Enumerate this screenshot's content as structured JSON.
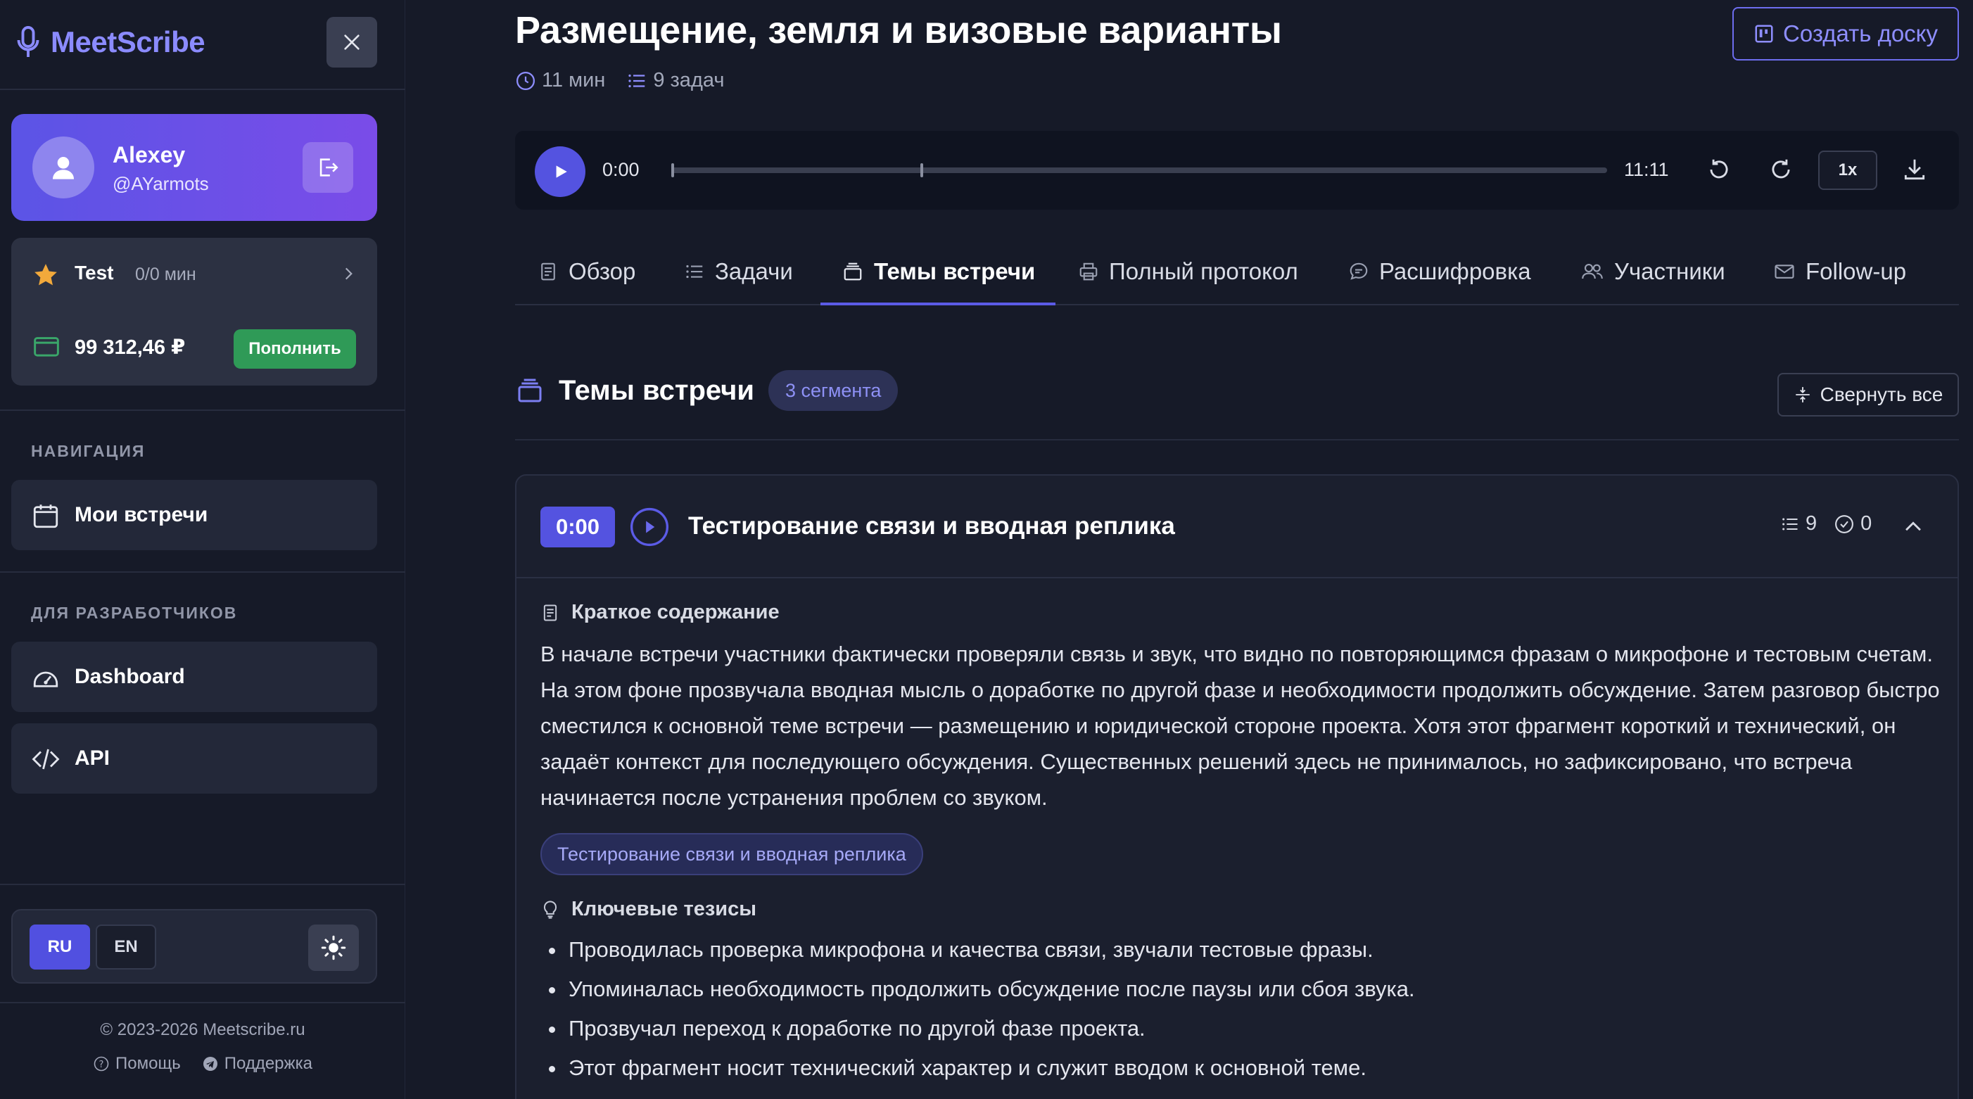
{
  "sidebar": {
    "brand": "MeetScribe",
    "user": {
      "name": "Alexey",
      "handle": "@AYarmots"
    },
    "plan": {
      "name": "Test",
      "minutes": "0/0 мин",
      "balance": "99 312,46 ₽",
      "topup_label": "Пополнить"
    },
    "nav_section": "НАВИГАЦИЯ",
    "nav_items": [
      {
        "label": "Мои встречи",
        "icon": "calendar-icon"
      }
    ],
    "dev_section": "ДЛЯ РАЗРАБОТЧИКОВ",
    "dev_items": [
      {
        "label": "Dashboard",
        "icon": "gauge-icon"
      },
      {
        "label": "API",
        "icon": "code-icon"
      }
    ],
    "lang": {
      "ru": "RU",
      "en": "EN",
      "active": "RU"
    },
    "copyright": "© 2023-2026 Meetscribe.ru",
    "footer": {
      "help": "Помощь",
      "support": "Поддержка"
    }
  },
  "header": {
    "title": "Размещение, земля и визовые варианты",
    "duration": "11 мин",
    "tasks": "9 задач",
    "create_board": "Создать доску"
  },
  "player": {
    "current": "0:00",
    "total": "11:11",
    "speed": "1x",
    "progress": 0
  },
  "tabs": [
    {
      "label": "Обзор",
      "icon": "document-icon"
    },
    {
      "label": "Задачи",
      "icon": "list-icon"
    },
    {
      "label": "Темы встречи",
      "icon": "layers-icon",
      "active": true
    },
    {
      "label": "Полный протокол",
      "icon": "printer-icon"
    },
    {
      "label": "Расшифровка",
      "icon": "chat-icon"
    },
    {
      "label": "Участники",
      "icon": "users-icon"
    },
    {
      "label": "Follow-up",
      "icon": "mail-icon"
    }
  ],
  "topics": {
    "title": "Темы встречи",
    "badge": "3 сегмента",
    "collapse_all": "Свернуть все",
    "segment": {
      "timestamp": "0:00",
      "title": "Тестирование связи и вводная реплика",
      "task_count": "9",
      "done_count": "0",
      "summary_heading": "Краткое содержание",
      "summary": "В начале встречи участники фактически проверяли связь и звук, что видно по повторяющимся фразам о микрофоне и тестовым счетам. На этом фоне прозвучала вводная мысль о доработке по другой фазе и необходимости продолжить обсуждение. Затем разговор быстро сместился к основной теме встречи — размещению и юридической стороне проекта. Хотя этот фрагмент короткий и технический, он задаёт контекст для последующего обсуждения. Существенных решений здесь не принималось, но зафиксировано, что встреча начинается после устранения проблем со звуком.",
      "tag": "Тестирование связи и вводная реплика",
      "theses_heading": "Ключевые тезисы",
      "theses": [
        "Проводилась проверка микрофона и качества связи, звучали тестовые фразы.",
        "Упоминалась необходимость продолжить обсуждение после паузы или сбоя звука.",
        "Прозвучал переход к доработке по другой фазе проекта.",
        "Этот фрагмент носит технический характер и служит вводом к основной теме."
      ]
    }
  },
  "colors": {
    "accent": "#5453e0",
    "sidebar_bg": "#161a28",
    "success": "#2f9a57"
  }
}
